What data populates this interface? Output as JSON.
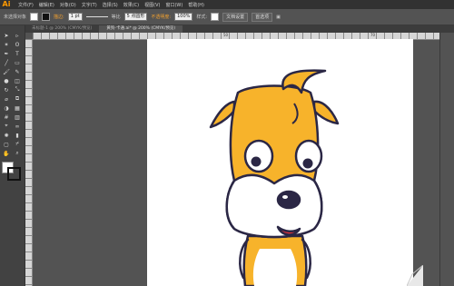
{
  "app": {
    "logo": "Ai"
  },
  "menu": [
    "文件(F)",
    "编辑(E)",
    "对象(O)",
    "文字(T)",
    "选择(S)",
    "效果(C)",
    "视图(V)",
    "窗口(W)",
    "帮助(H)"
  ],
  "control": {
    "selection_label": "未选择对象",
    "stroke_label": "描边:",
    "stroke_value": "1 pt",
    "line_style": "等比",
    "brush": "5 点圆形",
    "opacity_label": "不透明度:",
    "opacity_value": "100%",
    "style_label": "样式:",
    "doc_setup_button": "文档设置",
    "preferences_button": "首选项"
  },
  "tabs": [
    {
      "label": "未标题-1 @ 200% (CMYK/预览)",
      "active": false
    },
    {
      "label": "黄狗-卡通.ai* @ 200% (CMYK/预览)",
      "active": true
    }
  ],
  "ruler": {
    "ticks": [
      "50",
      "70"
    ]
  },
  "colors": {
    "accent": "#f7b32b",
    "outline": "#2b2745",
    "canvas": "#535353",
    "panel": "#424242"
  },
  "tools": [
    "selection-icon",
    "direct-selection-icon",
    "magic-wand-icon",
    "lasso-icon",
    "pen-icon",
    "type-icon",
    "line-icon",
    "rectangle-icon",
    "paintbrush-icon",
    "pencil-icon",
    "blob-brush-icon",
    "eraser-icon",
    "rotate-icon",
    "scale-icon",
    "width-icon",
    "free-transform-icon",
    "shape-builder-icon",
    "perspective-icon",
    "mesh-icon",
    "gradient-icon",
    "eyedropper-icon",
    "blend-icon",
    "symbol-sprayer-icon",
    "graph-icon",
    "artboard-icon",
    "slice-icon",
    "hand-icon",
    "zoom-icon"
  ]
}
